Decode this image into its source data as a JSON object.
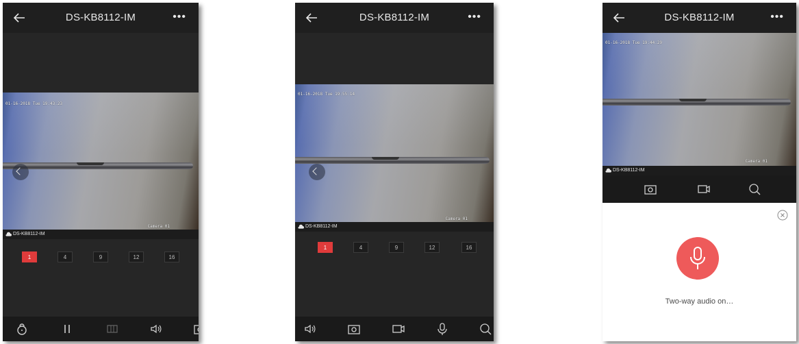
{
  "screens": [
    {
      "header": {
        "title": "DS-KB8112-IM"
      },
      "video": {
        "timestamp": "01-16-2018 Tue 19:43:23",
        "camera_label": "Camera 01"
      },
      "device_bar": {
        "name": "DS-KB8112-IM"
      },
      "grid_options": [
        "1",
        "4",
        "9",
        "12",
        "16"
      ],
      "selected_grid": "1",
      "toolbar": [
        "unlock-icon",
        "pause-icon",
        "multiscreen-icon",
        "speaker-icon",
        "snapshot-icon"
      ]
    },
    {
      "header": {
        "title": "DS-KB8112-IM"
      },
      "video": {
        "timestamp": "01-16-2018 Tue 19:55:14",
        "camera_label": "Camera 01"
      },
      "device_bar": {
        "name": "DS-KB8112-IM"
      },
      "grid_options": [
        "1",
        "4",
        "9",
        "12",
        "16"
      ],
      "selected_grid": "1",
      "toolbar": [
        "speaker-icon",
        "snapshot-icon",
        "record-icon",
        "microphone-icon",
        "zoom-icon"
      ]
    },
    {
      "header": {
        "title": "DS-KB8112-IM"
      },
      "video": {
        "timestamp": "01-16-2018 Tue 19:44:29",
        "camera_label": "Camera 01"
      },
      "device_bar": {
        "name": "DS-KB8112-IM"
      },
      "toolbar": [
        "snapshot-icon",
        "record-icon",
        "zoom-icon"
      ],
      "audio_panel": {
        "status": "Two-way audio on…"
      }
    }
  ],
  "colors": {
    "accent": "#e03b3b",
    "mic_button": "#ee5a5a",
    "background": "#262626"
  }
}
